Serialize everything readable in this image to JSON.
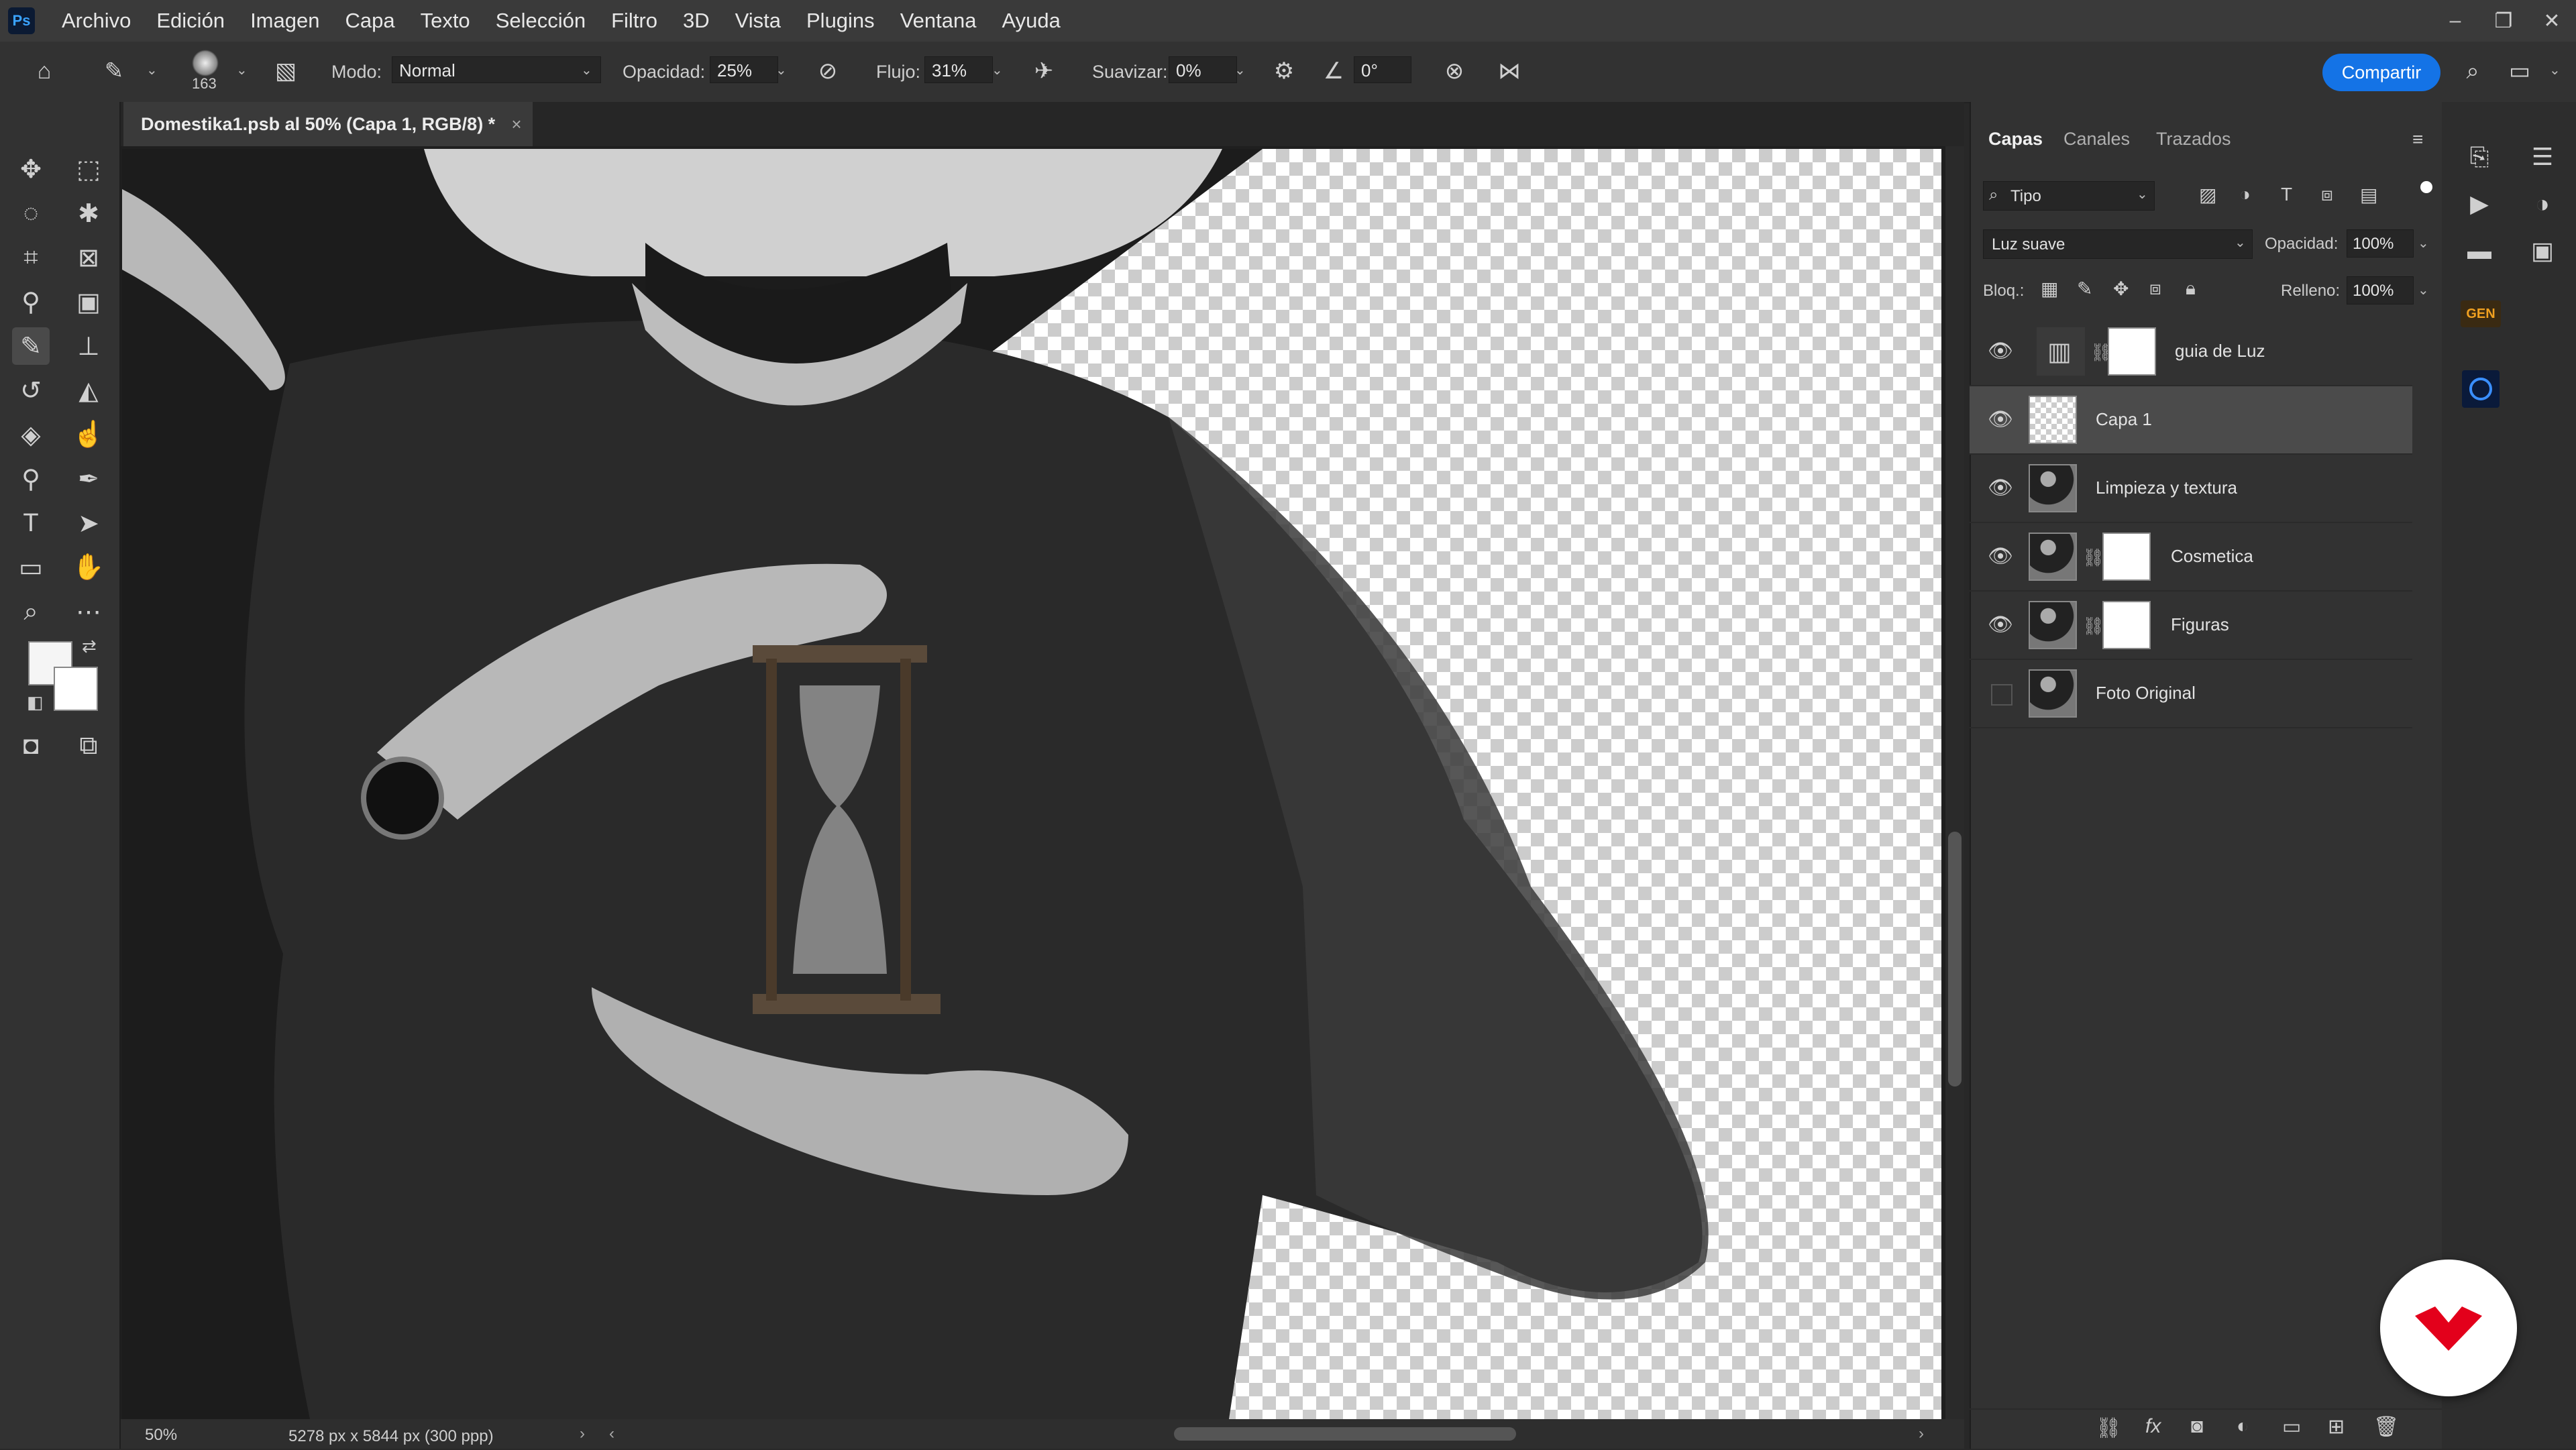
{
  "menubar": {
    "logo": "Ps",
    "items": [
      "Archivo",
      "Edición",
      "Imagen",
      "Capa",
      "Texto",
      "Selección",
      "Filtro",
      "3D",
      "Vista",
      "Plugins",
      "Ventana",
      "Ayuda"
    ],
    "window_controls": [
      "–",
      "❐",
      "✕"
    ]
  },
  "options": {
    "brush_size": "163",
    "mode_label": "Modo:",
    "mode_value": "Normal",
    "opacity_label": "Opacidad:",
    "opacity_value": "25%",
    "flow_label": "Flujo:",
    "flow_value": "31%",
    "smoothing_label": "Suavizar:",
    "smoothing_value": "0%",
    "angle_value": "0°",
    "share_label": "Compartir"
  },
  "document": {
    "tab_title": "Domestika1.psb al 50% (Capa 1, RGB/8) *",
    "zoom": "50%",
    "doc_info": "5278 px x 5844 px (300 ppp)"
  },
  "panel": {
    "tabs": [
      "Capas",
      "Canales",
      "Trazados"
    ],
    "filter_value": "Tipo",
    "blend_mode": "Luz suave",
    "opacity_label": "Opacidad:",
    "opacity_value": "100%",
    "lock_label": "Bloq.:",
    "fill_label": "Relleno:",
    "fill_value": "100%",
    "layers": [
      {
        "name": "guia de Luz",
        "visible": true,
        "selected": false
      },
      {
        "name": "Capa 1",
        "visible": true,
        "selected": true
      },
      {
        "name": "Limpieza y textura",
        "visible": true,
        "selected": false
      },
      {
        "name": "Cosmetica",
        "visible": true,
        "selected": false
      },
      {
        "name": "Figuras",
        "visible": true,
        "selected": false
      },
      {
        "name": "Foto Original",
        "visible": false,
        "selected": false
      }
    ],
    "footer_icons": [
      "link-icon",
      "fx-icon",
      "mask-icon",
      "adjustment-icon",
      "folder-icon",
      "new-layer-icon",
      "trash-icon"
    ]
  },
  "icons": {
    "home": "home-icon",
    "eye": "eye-icon",
    "brush": "brush-icon",
    "search": "search-icon"
  },
  "colors": {
    "accent": "#1473e6",
    "domestika_red": "#e3001b",
    "panel_bg": "#323232"
  }
}
